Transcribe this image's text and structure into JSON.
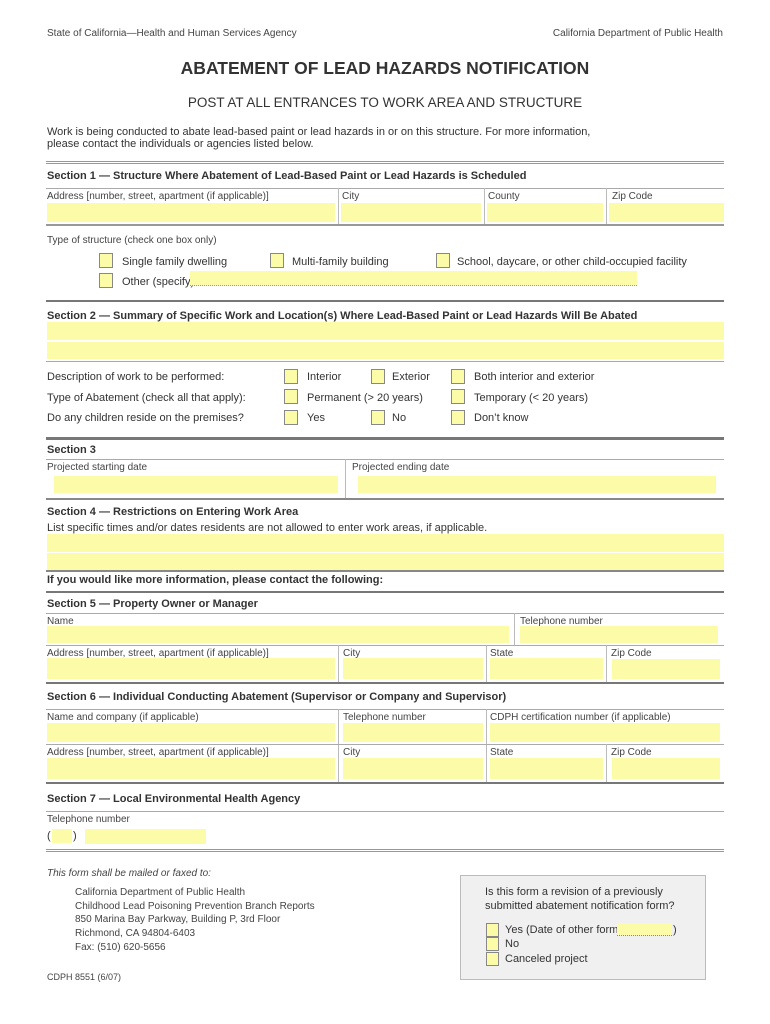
{
  "header": {
    "agency_left": "State of California—Health and Human Services Agency",
    "agency_right": "California Department of Public Health",
    "title": "ABATEMENT OF LEAD HAZARDS NOTIFICATION",
    "subtitle": "POST AT ALL ENTRANCES TO WORK AREA AND STRUCTURE",
    "intro_line1": "Work is being conducted to abate lead-based paint or lead hazards in or on this structure. For more information,",
    "intro_line2": "please contact the individuals or agencies listed below."
  },
  "section1": {
    "title": "Section 1 — Structure Where Abatement of Lead-Based Paint or Lead Hazards is Scheduled",
    "address_label": "Address [number, street, apartment (if applicable)]",
    "city_label": "City",
    "county_label": "County",
    "zip_label": "Zip Code",
    "address_value": "",
    "city_value": "",
    "county_value": "",
    "zip_value": "",
    "structure_type_label": "Type of structure (check one box only)",
    "structure_options": [
      {
        "label": "Single family dwelling",
        "checked": false
      },
      {
        "label": "Multi-family building",
        "checked": false
      },
      {
        "label": "School, daycare, or other child-occupied facility",
        "checked": false
      },
      {
        "label": "Other (specify)",
        "checked": false
      }
    ],
    "other_specify_value": ""
  },
  "section2": {
    "title": "Section 2 — Summary of Specific Work and Location(s) Where Lead-Based Paint or Lead Hazards Will Be Abated",
    "summary_line1": "",
    "summary_line2": "",
    "description_label": "Description of work to be performed:",
    "description_options": [
      "Interior",
      "Exterior",
      "Both interior and exterior"
    ],
    "abatement_type_label": "Type of Abatement (check all that apply):",
    "abatement_options": [
      "Permanent (> 20 years)",
      "Temporary (< 20 years)"
    ],
    "children_label": "Do any children reside on the premises?",
    "children_options": [
      "Yes",
      "No",
      "Don’t know"
    ]
  },
  "section3": {
    "title": "Section 3",
    "start_label": "Projected starting date",
    "end_label": "Projected ending date",
    "start_value": "",
    "end_value": ""
  },
  "section4": {
    "title": "Section 4 — Restrictions on Entering Work Area",
    "instructions": "List specific times and/or dates residents are not allowed to enter work areas, if applicable.",
    "line1": "",
    "line2": ""
  },
  "contact_heading": "If you would like more information, please contact the following:",
  "section5": {
    "title": "Section 5 — Property Owner or Manager",
    "name_label": "Name",
    "phone_label": "Telephone number",
    "address_label": "Address [number, street, apartment (if applicable)]",
    "city_label": "City",
    "state_label": "State",
    "zip_label": "Zip Code"
  },
  "section6": {
    "title": "Section 6 — Individual Conducting Abatement (Supervisor or Company and Supervisor)",
    "name_label": "Name and company (if applicable)",
    "phone_label": "Telephone number",
    "cert_label": "CDPH certification number (if applicable)",
    "address_label": "Address [number, street, apartment (if applicable)]",
    "city_label": "City",
    "state_label": "State",
    "zip_label": "Zip Code"
  },
  "section7": {
    "title": "Section 7 — Local Environmental Health Agency",
    "phone_label": "Telephone number",
    "paren_open": "(",
    "paren_close": ")",
    "area_code_value": "",
    "phone_value": ""
  },
  "footer": {
    "mail_heading": "This form shall be mailed or faxed to:",
    "address_lines": [
      "California Department of Public Health",
      "Childhood Lead Poisoning Prevention Branch Reports",
      "850 Marina Bay Parkway, Building P, 3rd Floor",
      "Richmond, CA 94804-6403",
      "Fax: (510) 620-5656"
    ],
    "form_number": "CDPH 8551 (6/07)"
  },
  "revision_box": {
    "question_line1": "Is this form a revision of a previously",
    "question_line2": "submitted abatement notification form?",
    "yes_label": "Yes (Date of other form:",
    "yes_close": ")",
    "no_label": "No",
    "canceled_label": "Canceled project",
    "date_value": ""
  },
  "colors": {
    "field_fill": "#fcfca8",
    "revision_box_bg": "#eff0ef",
    "text": "#333333"
  }
}
